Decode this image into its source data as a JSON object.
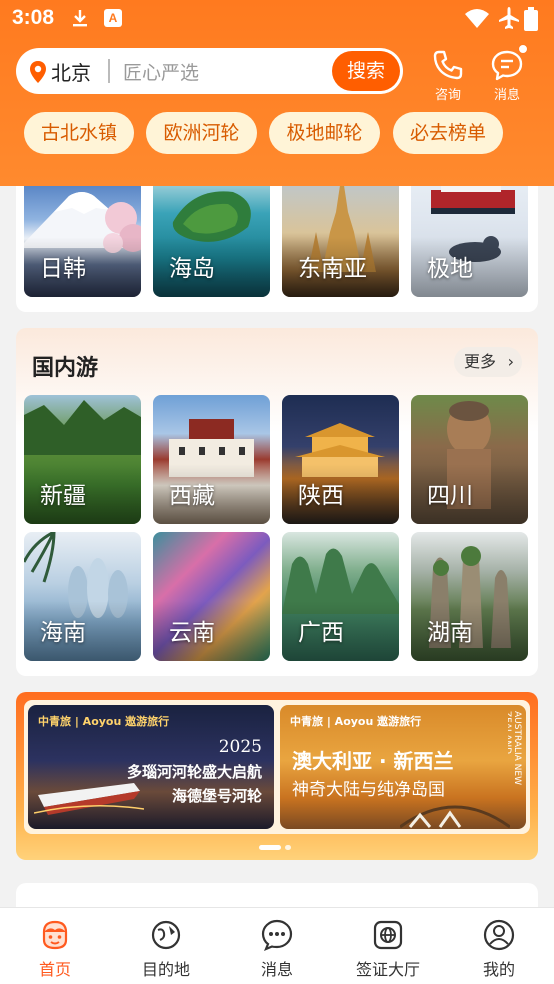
{
  "status_bar": {
    "time": "3:08",
    "icons": [
      "download-icon",
      "app-notification-icon",
      "wifi-icon",
      "airplane-mode-icon",
      "battery-icon"
    ]
  },
  "search": {
    "city": "北京",
    "placeholder": "匠心严选",
    "button": "搜索"
  },
  "top_actions": [
    {
      "label": "咨询",
      "icon": "phone-icon"
    },
    {
      "label": "消息",
      "icon": "message-icon"
    }
  ],
  "quick_tags": [
    "古北水镇",
    "欧洲河轮",
    "极地邮轮",
    "必去榜单"
  ],
  "outbound_tiles": [
    "日韩",
    "海岛",
    "东南亚",
    "极地"
  ],
  "domestic": {
    "title": "国内游",
    "more": "更多",
    "tiles": [
      "新疆",
      "西藏",
      "陕西",
      "四川",
      "海南",
      "云南",
      "广西",
      "湖南"
    ]
  },
  "banners": [
    {
      "brand": "中青旅 | Aoyou 遨游旅行",
      "year": "2025",
      "line1": "多瑙河河轮盛大启航",
      "line2": "海德堡号河轮"
    },
    {
      "brand": "中青旅 | Aoyou 遨游旅行",
      "line1": "澳大利亚 · 新西兰",
      "line2": "神奇大陆与纯净岛国",
      "side": "AUSTRALIA NEW ZEALAND"
    }
  ],
  "bottom_nav": [
    {
      "label": "首页",
      "icon": "home-face-icon",
      "active": true
    },
    {
      "label": "目的地",
      "icon": "destination-icon",
      "active": false
    },
    {
      "label": "消息",
      "icon": "chat-bubble-icon",
      "active": false
    },
    {
      "label": "签证大厅",
      "icon": "visa-globe-icon",
      "active": false
    },
    {
      "label": "我的",
      "icon": "profile-icon",
      "active": false
    }
  ],
  "colors": {
    "brand_orange": "#ff7a1f",
    "search_button": "#ff5e00",
    "tag_bg": "#fff4d7",
    "tag_text": "#d85b00",
    "nav_active": "#ff5a1f"
  }
}
